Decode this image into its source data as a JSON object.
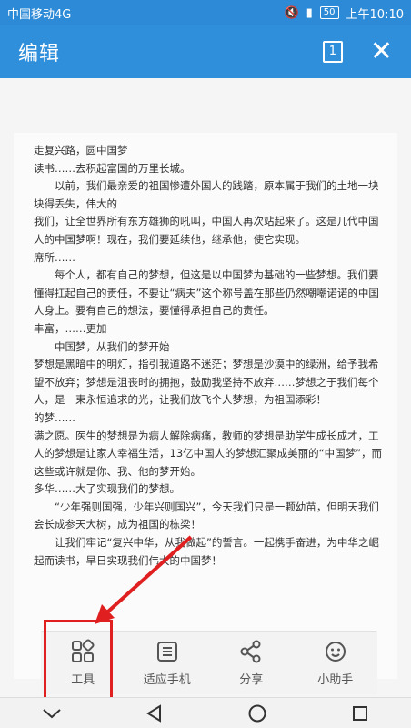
{
  "status": {
    "carrier": "中国移动4G",
    "battery": "50",
    "time": "上午10:10"
  },
  "app_bar": {
    "title": "编辑",
    "page_count": "1"
  },
  "document": {
    "lines": [
      {
        "text": "走复兴路，圆中国梦",
        "indent": false
      },
      {
        "text": "读书……去积起富国的万里长城。",
        "indent": false
      },
      {
        "text": "以前，我们最亲爱的祖国惨遭外国人的践踏，原本属于我们的土地一块块得丢失，伟大的",
        "indent": true
      },
      {
        "text": "我们，让全世界所有东方雄狮的吼叫，中国人再次站起来了。这是几代中国人的中国梦啊！现在，我们要延续他，继承他，使它实现。",
        "indent": false
      },
      {
        "text": "席所……",
        "indent": false
      },
      {
        "text": "每个人，都有自己的梦想，但这是以中国梦为基础的一些梦想。我们要懂得扛起自己的责任，不要让“病夫”这个称号盖在那些仍然嘲嘲诺诺的中国人身上。要有自己的想法，要懂得承担自己的责任。",
        "indent": true
      },
      {
        "text": "丰富，……更加",
        "indent": false
      },
      {
        "text": "中国梦，从我们的梦开始",
        "indent": true
      },
      {
        "text": "梦想是黑暗中的明灯，指引我道路不迷茫；梦想是沙漠中的绿洲，给予我希望不放弃；梦想是沮丧时的拥抱，鼓励我坚持不放弃……梦想之于我们每个人，是一束永恒追求的光，让我们放飞个人梦想，为祖国添彩！",
        "indent": false
      },
      {
        "text": "的梦……",
        "indent": false
      },
      {
        "text": "满之愿。医生的梦想是为病人解除病痛，教师的梦想是助学生成长成才，工人的梦想是让家人幸福生活，13亿中国人的梦想汇聚成美丽的“中国梦”，而这些或许就是你、我、他的梦开始。",
        "indent": false
      },
      {
        "text": "多华……大了实现我们的梦想。",
        "indent": false
      },
      {
        "text": "“少年强则国强，少年兴则国兴”，今天我们只是一颗幼苗，但明天我们会长成参天大树，成为祖国的栋梁！",
        "indent": true
      },
      {
        "text": "让我们牢记“复兴中华，从我做起”的誓言。一起携手奋进，为中华之崛起而读书，早日实现我们伟大的中国梦！",
        "indent": true
      }
    ]
  },
  "toolbar": {
    "items": [
      {
        "label": "工具",
        "icon": "tools-grid-icon"
      },
      {
        "label": "适应手机",
        "icon": "fit-phone-icon"
      },
      {
        "label": "分享",
        "icon": "share-icon"
      },
      {
        "label": "小助手",
        "icon": "assistant-icon"
      }
    ]
  },
  "colors": {
    "app_bar": "#2f8fdb",
    "highlight": "#e02020"
  }
}
